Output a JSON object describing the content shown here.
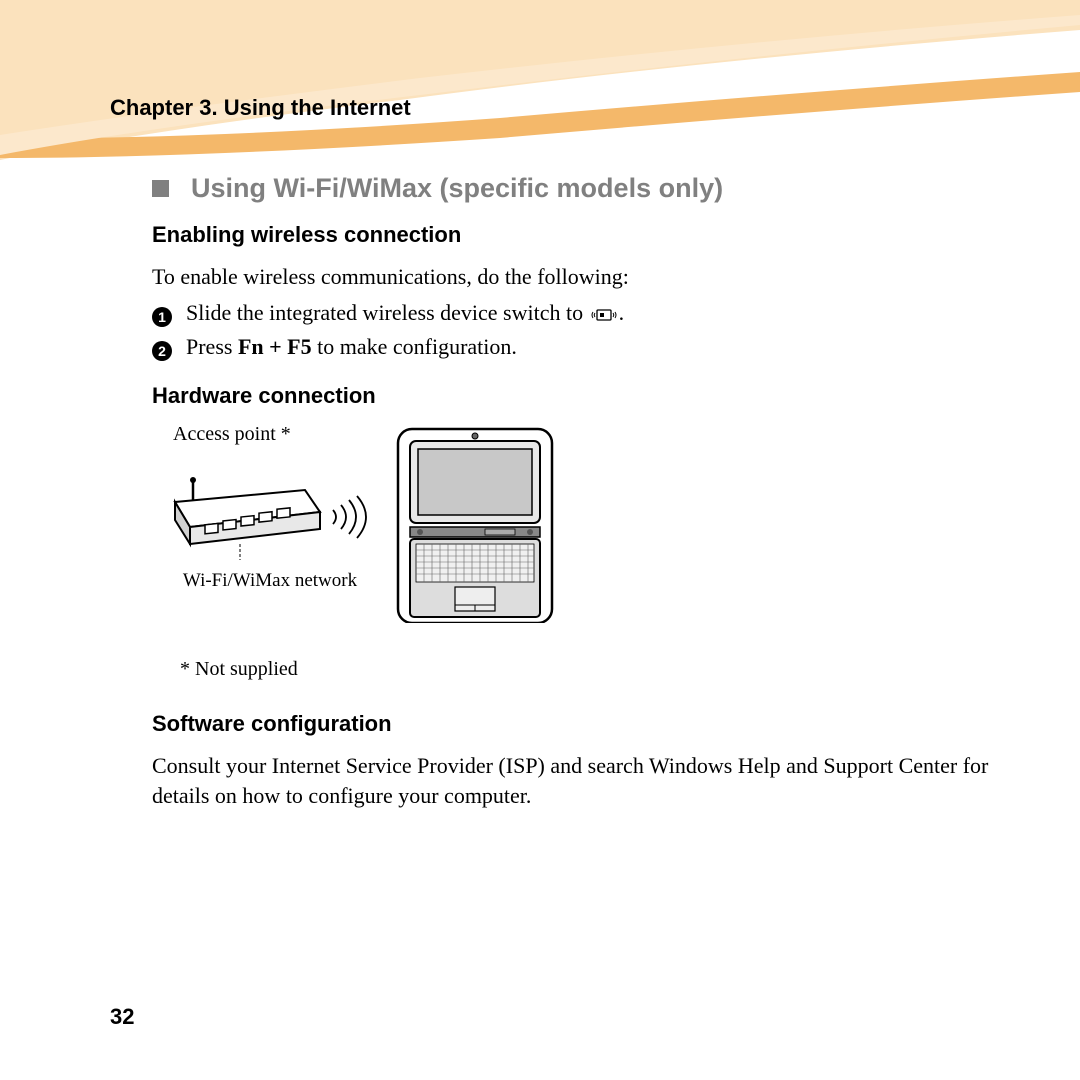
{
  "chapter": "Chapter 3. Using the Internet",
  "section": {
    "title": "Using Wi-Fi/WiMax (specific models only)"
  },
  "enabling": {
    "heading": "Enabling wireless connection",
    "intro": "To enable wireless communications, do the following:",
    "steps": {
      "s1_a": "Slide the integrated wireless device switch to ",
      "s1_b": ".",
      "s2_a": "Press ",
      "s2_bold": "Fn + F5",
      "s2_b": " to make configuration."
    }
  },
  "hardware": {
    "heading": "Hardware connection",
    "access_point": "Access point *",
    "network": "Wi-Fi/WiMax network",
    "footnote": "* Not supplied"
  },
  "software": {
    "heading": "Software configuration",
    "body": "Consult your Internet Service Provider (ISP) and search Windows Help and Support Center for details on how to configure your computer."
  },
  "page_number": "32"
}
